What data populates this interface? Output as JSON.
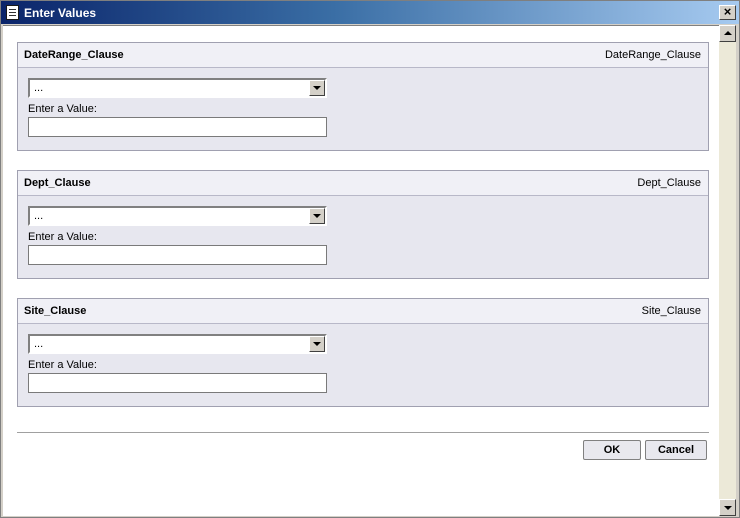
{
  "window": {
    "title": "Enter Values",
    "close_glyph": "×"
  },
  "panels": [
    {
      "title": "DateRange_Clause",
      "name": "DateRange_Clause",
      "selected": "...",
      "value_label": "Enter a Value:",
      "value": ""
    },
    {
      "title": "Dept_Clause",
      "name": "Dept_Clause",
      "selected": "...",
      "value_label": "Enter a Value:",
      "value": ""
    },
    {
      "title": "Site_Clause",
      "name": "Site_Clause",
      "selected": "...",
      "value_label": "Enter a Value:",
      "value": ""
    }
  ],
  "buttons": {
    "ok": "OK",
    "cancel": "Cancel"
  },
  "colors": {
    "titlebar_start": "#0a246a",
    "titlebar_end": "#a6caf0",
    "panel_bg": "#e7e7ef"
  },
  "icons": {
    "app": "document-icon",
    "close": "close-icon",
    "scroll_up": "arrow-up-icon",
    "scroll_down": "arrow-down-icon",
    "dropdown": "chevron-down-icon"
  }
}
